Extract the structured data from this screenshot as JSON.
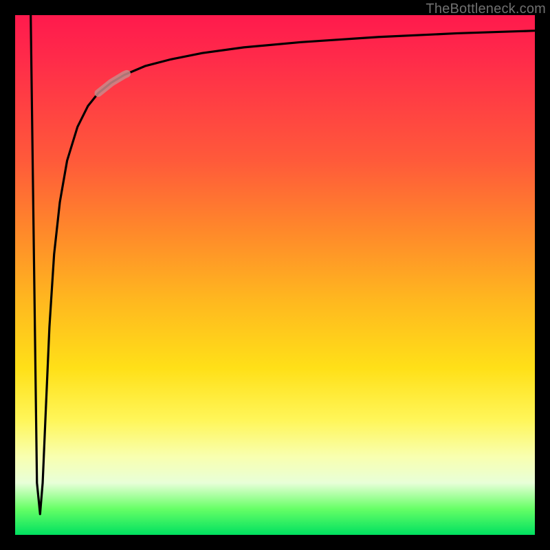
{
  "watermark": "TheBottleneck.com",
  "colors": {
    "gradient_top": "#ff1a4d",
    "gradient_mid1": "#ff8a2a",
    "gradient_mid2": "#ffe018",
    "gradient_mid3": "#f8ffb0",
    "gradient_bottom": "#00e060",
    "curve": "#000000",
    "highlight_segment": "#c98a8a",
    "frame": "#000000"
  },
  "chart_data": {
    "type": "line",
    "title": "",
    "xlabel": "",
    "ylabel": "",
    "xlim": [
      0,
      100
    ],
    "ylim": [
      0,
      100
    ],
    "note": "y≈100 corresponds to top of plot; values estimated from pixel positions",
    "series": [
      {
        "name": "bottleneck-curve",
        "x": [
          3.0,
          3.6,
          4.2,
          4.8,
          5.3,
          5.9,
          6.6,
          7.5,
          8.6,
          10.0,
          12.0,
          14.0,
          16.0,
          18.5,
          21.0,
          25.0,
          30.0,
          36.0,
          44.0,
          55.0,
          70.0,
          85.0,
          100.0
        ],
        "y": [
          100.0,
          55.0,
          10.0,
          4.0,
          10.0,
          24.0,
          40.0,
          54.0,
          64.0,
          72.0,
          78.5,
          82.5,
          85.0,
          87.0,
          88.5,
          90.2,
          91.5,
          92.7,
          93.8,
          94.8,
          95.8,
          96.5,
          97.0
        ]
      }
    ],
    "highlight_segment": {
      "series": "bottleneck-curve",
      "x_start": 16.0,
      "x_end": 21.5
    }
  }
}
